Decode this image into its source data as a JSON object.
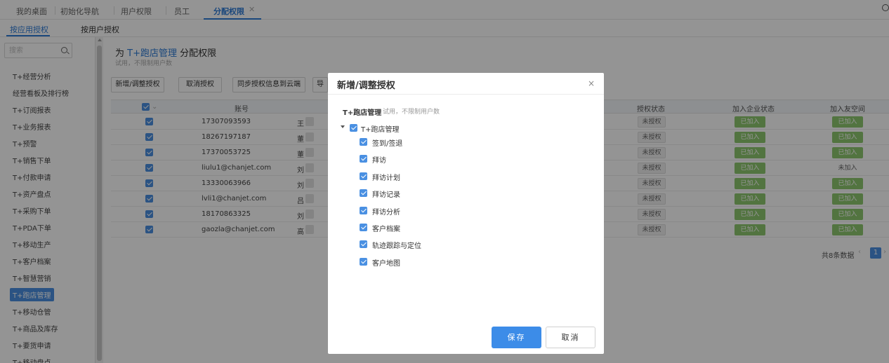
{
  "top_tabs": [
    {
      "label": "我的桌面"
    },
    {
      "label": "初始化导航"
    },
    {
      "label": "用户权限"
    },
    {
      "label": "员工"
    },
    {
      "label": "分配权限"
    }
  ],
  "sub_tabs": [
    {
      "label": "按应用授权"
    },
    {
      "label": "按用户授权"
    }
  ],
  "sidebar": {
    "search_placeholder": "搜索",
    "items": [
      {
        "label": "T+经营分析"
      },
      {
        "label": "经营看板及排行榜"
      },
      {
        "label": "T+订阅报表"
      },
      {
        "label": "T+业务报表"
      },
      {
        "label": "T+预警"
      },
      {
        "label": "T+销售下单"
      },
      {
        "label": "T+付款申请"
      },
      {
        "label": "T+资产盘点"
      },
      {
        "label": "T+采购下单"
      },
      {
        "label": "T+PDA下单"
      },
      {
        "label": "T+移动生产"
      },
      {
        "label": "T+客户档案"
      },
      {
        "label": "T+智慧营销"
      },
      {
        "label": "T+跑店管理"
      },
      {
        "label": "T+移动仓管"
      },
      {
        "label": "T+商品及库存"
      },
      {
        "label": "T+要货申请"
      },
      {
        "label": "T+移动盘点"
      }
    ],
    "active_index": 13
  },
  "main": {
    "title_prefix": "为",
    "title_app": "T+跑店管理",
    "title_suffix": "分配权限",
    "subtitle": "试用，不限制用户数",
    "buttons": [
      {
        "label": "新增/调整授权"
      },
      {
        "label": "取消授权"
      },
      {
        "label": "同步授权信息到云端"
      },
      {
        "label": "导"
      }
    ],
    "columns": {
      "account": "账号",
      "auth_status": "授权状态",
      "company_status": "加入企业状态",
      "friend_space": "加入友空间"
    },
    "rows": [
      {
        "account": "17307093593",
        "name": "王",
        "auth": "未授权",
        "company": "已加入",
        "friend": "已加入"
      },
      {
        "account": "18267197187",
        "name": "董",
        "auth": "未授权",
        "company": "已加入",
        "friend": "已加入"
      },
      {
        "account": "17370053725",
        "name": "董",
        "auth": "未授权",
        "company": "已加入",
        "friend": "已加入"
      },
      {
        "account": "liulu1@chanjet.com",
        "name": "刘",
        "auth": "未授权",
        "company": "已加入",
        "friend": "未加入"
      },
      {
        "account": "13330063966",
        "name": "刘",
        "auth": "未授权",
        "company": "已加入",
        "friend": "已加入"
      },
      {
        "account": "lvli1@chanjet.com",
        "name": "吕",
        "auth": "未授权",
        "company": "已加入",
        "friend": "已加入"
      },
      {
        "account": "18170863325",
        "name": "刘",
        "auth": "未授权",
        "company": "已加入",
        "friend": "已加入"
      },
      {
        "account": "gaozla@chanjet.com",
        "name": "高",
        "auth": "未授权",
        "company": "已加入",
        "friend": "已加入"
      }
    ],
    "pager": {
      "total_text": "共8条数据",
      "current_page": "1"
    }
  },
  "dialog": {
    "title": "新增/调整授权",
    "close_glyph": "×",
    "app_name": "T+跑店管理",
    "app_note": "试用，不限制用户数",
    "tree_root": "T+跑店管理",
    "tree_children": [
      {
        "label": "签到/签退"
      },
      {
        "label": "拜访"
      },
      {
        "label": "拜访计划"
      },
      {
        "label": "拜访记录"
      },
      {
        "label": "拜访分析"
      },
      {
        "label": "客户档案"
      },
      {
        "label": "轨迹跟踪与定位"
      },
      {
        "label": "客户地图"
      }
    ],
    "save_label": "保存",
    "cancel_label": "取消"
  },
  "colors": {
    "accent": "#2e7bd6",
    "checkbox": "#4a90e2",
    "joined_tag": "#8ec86f",
    "save_button": "#3c8ce8"
  }
}
